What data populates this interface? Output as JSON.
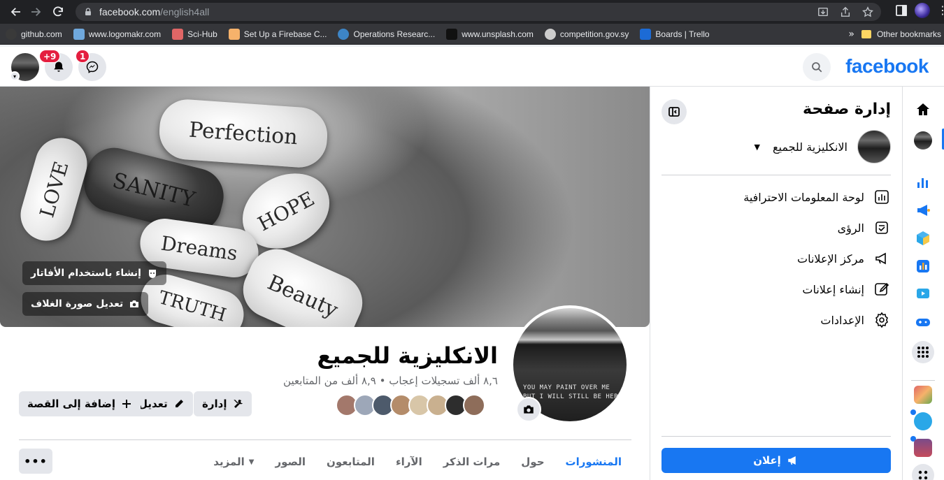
{
  "browser": {
    "url_host": "facebook.com",
    "url_path": "/english4all",
    "bookmarks": [
      {
        "label": "github.com",
        "color": "#3a3a3a"
      },
      {
        "label": "www.logomakr.com",
        "color": "#6fa8dc"
      },
      {
        "label": "Sci-Hub",
        "color": "#e06666"
      },
      {
        "label": "Set Up a Firebase C...",
        "color": "#f6b26b"
      },
      {
        "label": "Operations Researc...",
        "color": "#3d85c6"
      },
      {
        "label": "www.unsplash.com",
        "color": "#111111"
      },
      {
        "label": "competition.gov.sy",
        "color": "#cccccc"
      },
      {
        "label": "Boards | Trello",
        "color": "#1c6bd6"
      }
    ],
    "bookmarks_more": "»",
    "other_bookmarks": "Other bookmarks"
  },
  "topbar": {
    "logo": "facebook",
    "notifications_badge": "+9",
    "messenger_badge": "1"
  },
  "manage": {
    "title": "إدارة صفحة",
    "page_name": "الانكليزية للجميع",
    "menu": [
      {
        "label": "لوحة المعلومات الاحترافية",
        "icon": "dashboard-icon"
      },
      {
        "label": "الرؤى",
        "icon": "insights-icon"
      },
      {
        "label": "مركز الإعلانات",
        "icon": "megaphone-icon"
      },
      {
        "label": "إنشاء إعلانات",
        "icon": "edit-ad-icon"
      },
      {
        "label": "الإعدادات",
        "icon": "gear-icon"
      }
    ],
    "promote_label": "إعلان"
  },
  "cover": {
    "avatar_button": "إنشاء باستخدام الأفاتار",
    "edit_cover_button": "تعديل صورة الغلاف",
    "pill_words": [
      "Perfection",
      "SANITY",
      "HOPE",
      "LOVE",
      "Dreams",
      "Beauty",
      "TRUTH"
    ]
  },
  "profile": {
    "name": "الانكليزية للجميع",
    "stats": "٨,٦ ألف تسجيلات إعجاب • ٨,٩ ألف من المتابعين",
    "avatar_text": "YOU MAY PAINT OVER ME\nBUT I WILL STILL BE HERE",
    "friend_colors": [
      "#8e6d5a",
      "#2d2d2d",
      "#c9b08f",
      "#d8c6a8",
      "#b48c6a",
      "#4d5a6b",
      "#9da7b8",
      "#a3786b"
    ]
  },
  "actions": {
    "manage": "إدارة",
    "edit": "تعديل",
    "add_story": "إضافة إلى القصة"
  },
  "tabs": [
    {
      "label": "المنشورات",
      "active": true
    },
    {
      "label": "حول",
      "active": false
    },
    {
      "label": "مرات الذكر",
      "active": false
    },
    {
      "label": "الآراء",
      "active": false
    },
    {
      "label": "المتابعون",
      "active": false
    },
    {
      "label": "الصور",
      "active": false
    },
    {
      "label": "المزيد",
      "active": false
    }
  ],
  "more_dots": "•••",
  "colors": {
    "fb_blue": "#1877f2",
    "badge_red": "#e41e3f",
    "chrome_dark": "#202124"
  }
}
